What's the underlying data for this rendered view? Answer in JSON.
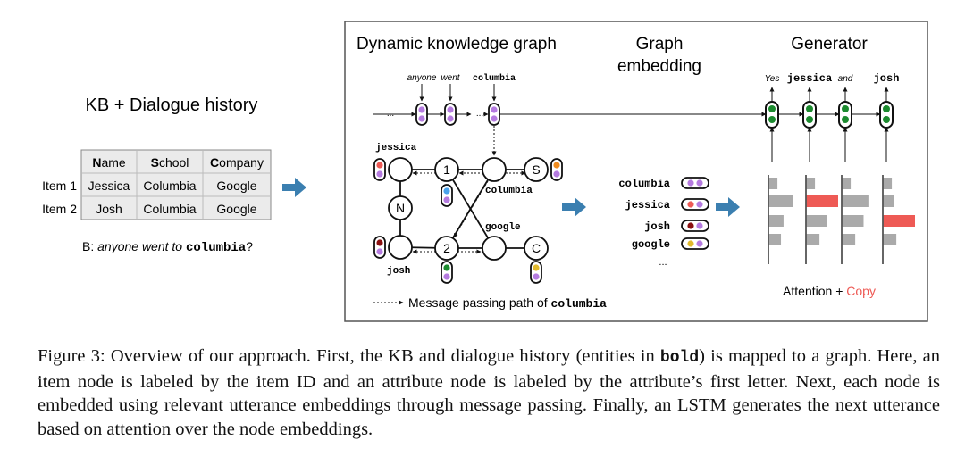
{
  "figure": {
    "kb_title": "KB + Dialogue history",
    "table": {
      "headers": [
        {
          "initial": "N",
          "rest": "ame"
        },
        {
          "initial": "S",
          "rest": "chool"
        },
        {
          "initial": "C",
          "rest": "ompany"
        }
      ],
      "rows": [
        {
          "label": "Item 1",
          "cells": [
            "Jessica",
            "Columbia",
            "Google"
          ]
        },
        {
          "label": "Item 2",
          "cells": [
            "Josh",
            "Columbia",
            "Google"
          ]
        }
      ]
    },
    "utterance": {
      "prefix": "B: ",
      "italic": "anyone went to ",
      "entity": "columbia",
      "suffix": "?"
    },
    "panel_titles": {
      "graph": "Dynamic knowledge graph",
      "embedding_line1": "Graph",
      "embedding_line2": "embedding",
      "generator": "Generator"
    },
    "input_words": {
      "w1": "anyone",
      "w2": "went",
      "w3": "columbia"
    },
    "ellipsis": "...",
    "nodes": {
      "n1": "1",
      "n2": "2",
      "S": "S",
      "N": "N",
      "C": "C",
      "jessica": "jessica",
      "josh": "josh",
      "columbia": "columbia",
      "google": "google"
    },
    "legend": {
      "text": "Message passing path of ",
      "entity": "columbia"
    },
    "embeddings": [
      {
        "label": "columbia",
        "colors": [
          "#b57be0",
          "#b57be0"
        ]
      },
      {
        "label": "jessica",
        "colors": [
          "#ee5a55",
          "#b57be0"
        ]
      },
      {
        "label": "josh",
        "colors": [
          "#8b1010",
          "#b57be0"
        ]
      },
      {
        "label": "google",
        "colors": [
          "#e0b92c",
          "#b57be0"
        ]
      }
    ],
    "embedding_ellipsis": "...",
    "output_words": [
      {
        "text": "Yes",
        "style": "italic"
      },
      {
        "text": "jessica",
        "style": "mono"
      },
      {
        "text": "and",
        "style": "italic"
      },
      {
        "text": "josh",
        "style": "mono"
      }
    ],
    "attention": {
      "weights": [
        [
          0.28,
          0.75,
          0.47,
          0.39
        ],
        [
          0.28,
          1.0,
          0.64,
          0.42
        ],
        [
          0.28,
          0.83,
          0.68,
          0.42
        ],
        [
          0.28,
          0.36,
          1.0,
          0.42
        ]
      ],
      "copied_index": [
        null,
        1,
        null,
        2
      ]
    },
    "attention_label": {
      "a": "Attention + ",
      "b": "Copy"
    },
    "colors": {
      "arrow": "#3b7fb0",
      "copy": "#ee5a55",
      "bar": "#aaaaaa",
      "purple": "#b57be0",
      "green": "#1b8a2e",
      "blue": "#4aa3ec",
      "orange": "#f08c1e",
      "table_bg": "#ebebeb"
    }
  },
  "caption": {
    "p1": "Figure 3:  Overview of our approach. First, the KB and dialogue history (entities in ",
    "bold": "bold",
    "p2": ") is mapped to a graph. Here, an item node is labeled by the item ID and an attribute node is labeled by the attribute’s first letter. Next, each node is embedded using relevant utterance embeddings through message passing. Finally, an LSTM generates the next utterance based on attention over the node embeddings."
  }
}
